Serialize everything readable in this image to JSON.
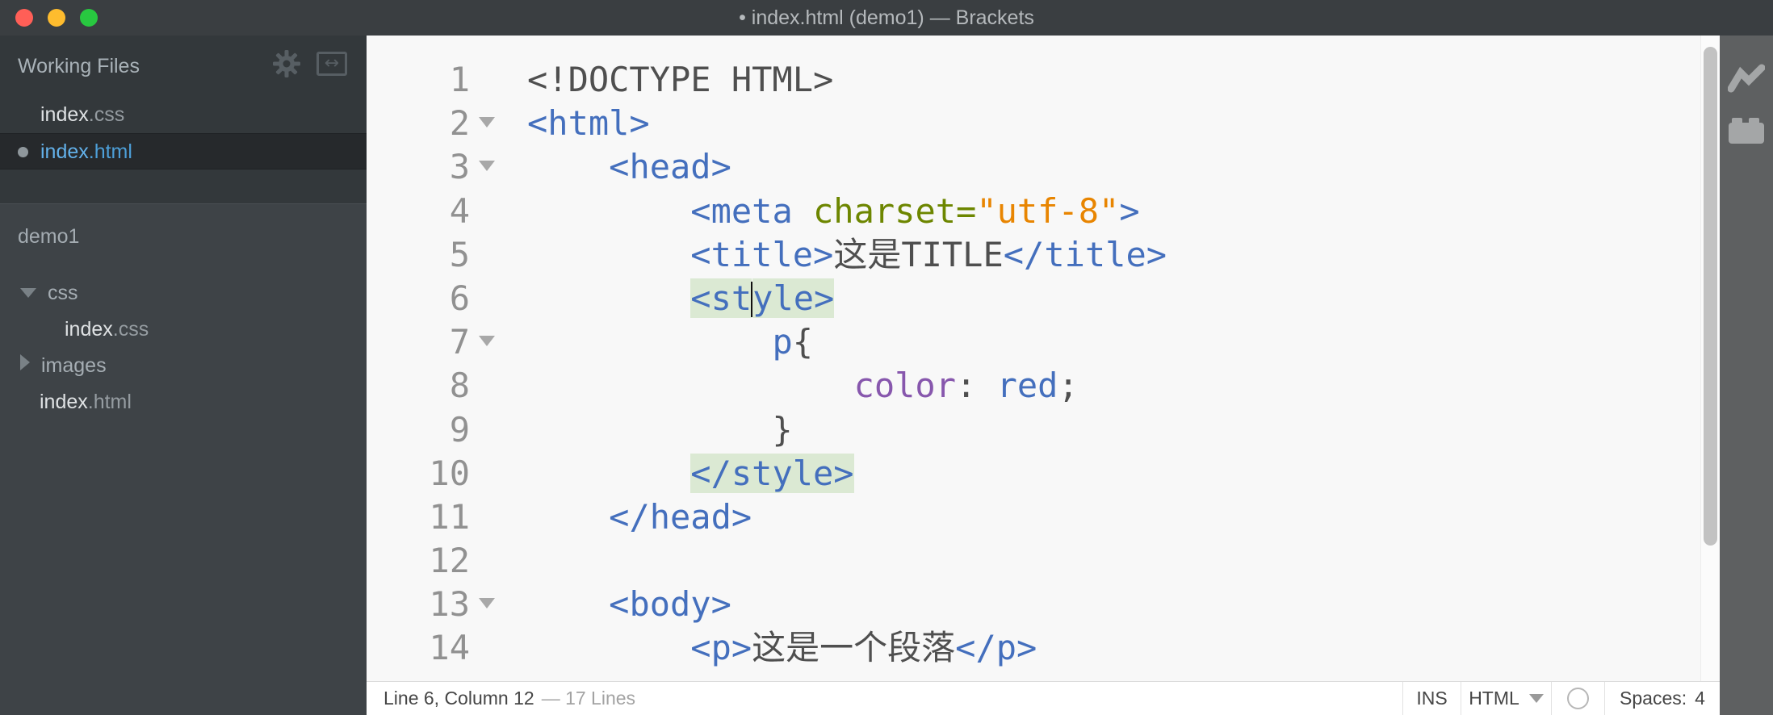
{
  "window": {
    "title": "• index.html (demo1) — Brackets"
  },
  "titlebar": {
    "traffic_lights": [
      {
        "name": "close",
        "color": "#ff5f57"
      },
      {
        "name": "minimize",
        "color": "#febc2e"
      },
      {
        "name": "zoom",
        "color": "#28c840"
      }
    ]
  },
  "sidebar": {
    "working_files_header": "Working Files",
    "working_files": [
      {
        "name": "index",
        "ext": ".css",
        "modified": false,
        "selected": false
      },
      {
        "name": "index",
        "ext": ".html",
        "modified": true,
        "selected": true
      }
    ],
    "project_name": "demo1",
    "tree": [
      {
        "kind": "folder",
        "label": "css",
        "state": "expanded",
        "indent": 0
      },
      {
        "kind": "file",
        "name": "index",
        "ext": ".css",
        "indent": 1
      },
      {
        "kind": "folder",
        "label": "images",
        "state": "collapsed",
        "indent": 0
      },
      {
        "kind": "file",
        "name": "index",
        "ext": ".html",
        "indent": 0
      }
    ]
  },
  "editor": {
    "lines": [
      {
        "num": "1",
        "fold": false,
        "tokens": [
          {
            "s": "<!DOCTYPE HTML>",
            "c": "plain"
          }
        ]
      },
      {
        "num": "2",
        "fold": true,
        "tokens": [
          {
            "s": "<html>",
            "c": "tag"
          }
        ]
      },
      {
        "num": "3",
        "fold": true,
        "tokens": [
          {
            "s": "    ",
            "c": "plain"
          },
          {
            "s": "<head>",
            "c": "tag"
          }
        ]
      },
      {
        "num": "4",
        "fold": false,
        "tokens": [
          {
            "s": "        ",
            "c": "plain"
          },
          {
            "s": "<meta ",
            "c": "tag"
          },
          {
            "s": "charset=",
            "c": "attr"
          },
          {
            "s": "\"utf-8\"",
            "c": "string"
          },
          {
            "s": ">",
            "c": "tag"
          }
        ]
      },
      {
        "num": "5",
        "fold": false,
        "tokens": [
          {
            "s": "        ",
            "c": "plain"
          },
          {
            "s": "<title>",
            "c": "tag"
          },
          {
            "s": "这是TITLE",
            "c": "plain"
          },
          {
            "s": "</title>",
            "c": "tag"
          }
        ]
      },
      {
        "num": "6",
        "fold": false,
        "tokens": [
          {
            "s": "        ",
            "c": "plain"
          },
          {
            "s": "<st",
            "c": "hl"
          },
          {
            "caret": true
          },
          {
            "s": "yle>",
            "c": "hl"
          }
        ]
      },
      {
        "num": "7",
        "fold": true,
        "tokens": [
          {
            "s": "            ",
            "c": "plain"
          },
          {
            "s": "p",
            "c": "tag"
          },
          {
            "s": "{",
            "c": "plain"
          }
        ]
      },
      {
        "num": "8",
        "fold": false,
        "tokens": [
          {
            "s": "                ",
            "c": "plain"
          },
          {
            "s": "color",
            "c": "prop"
          },
          {
            "s": ": ",
            "c": "plain"
          },
          {
            "s": "red",
            "c": "tag"
          },
          {
            "s": ";",
            "c": "plain"
          }
        ]
      },
      {
        "num": "9",
        "fold": false,
        "tokens": [
          {
            "s": "            }",
            "c": "plain"
          }
        ]
      },
      {
        "num": "10",
        "fold": false,
        "tokens": [
          {
            "s": "        ",
            "c": "plain"
          },
          {
            "s": "</style>",
            "c": "hl"
          }
        ]
      },
      {
        "num": "11",
        "fold": false,
        "tokens": [
          {
            "s": "    ",
            "c": "plain"
          },
          {
            "s": "</head>",
            "c": "tag"
          }
        ]
      },
      {
        "num": "12",
        "fold": false,
        "tokens": []
      },
      {
        "num": "13",
        "fold": true,
        "tokens": [
          {
            "s": "    ",
            "c": "plain"
          },
          {
            "s": "<body>",
            "c": "tag"
          }
        ]
      },
      {
        "num": "14",
        "fold": false,
        "tokens": [
          {
            "s": "        ",
            "c": "plain"
          },
          {
            "s": "<p>",
            "c": "tag"
          },
          {
            "s": "这是一个段落",
            "c": "plain"
          },
          {
            "s": "</p>",
            "c": "tag"
          }
        ]
      }
    ]
  },
  "statusbar": {
    "cursor_info": "Line 6, Column 12",
    "lines_info": "— 17 Lines",
    "insert_mode": "INS",
    "language": "HTML",
    "spaces_label": "Spaces:",
    "spaces_value": "4"
  },
  "colors": {
    "plain": "#4f4f4f",
    "tag": "#446fbd",
    "attr": "#6d8600",
    "string": "#e88501",
    "prop": "#8757ad",
    "hl": "#446fbd",
    "match_highlight_bg": "#dbe9d3",
    "editor_bg": "#f8f8f8",
    "sidebar_bg": "#33383b",
    "project_bg": "#3e4347",
    "selected_file_text": "#63b1ea",
    "toolbar_bg": "#5e6061"
  }
}
